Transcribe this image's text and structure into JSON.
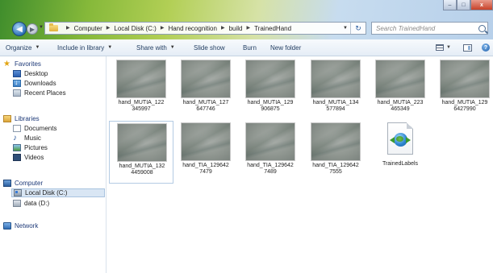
{
  "window": {
    "controls": [
      "–",
      "□",
      "x"
    ]
  },
  "address_bar": {
    "crumbs": [
      "Computer",
      "Local Disk (C:)",
      "Hand recognition",
      "build",
      "TrainedHand"
    ],
    "refresh_glyph": "↻"
  },
  "search": {
    "placeholder": "Search TrainedHand"
  },
  "toolbar": {
    "organize": "Organize",
    "include_in_library": "Include in library",
    "share_with": "Share with",
    "slide_show": "Slide show",
    "burn": "Burn",
    "new_folder": "New folder",
    "help": "?"
  },
  "nav": {
    "favorites": "Favorites",
    "desktop": "Desktop",
    "downloads": "Downloads",
    "recent_places": "Recent Places",
    "libraries": "Libraries",
    "documents": "Documents",
    "music": "Music",
    "pictures": "Pictures",
    "videos": "Videos",
    "computer": "Computer",
    "local_disk_c": "Local Disk (C:)",
    "data_d": "data (D:)",
    "network": "Network"
  },
  "files": [
    {
      "l1": "hand_MUTIA_122",
      "l2": "345997",
      "type": "image"
    },
    {
      "l1": "hand_MUTIA_127",
      "l2": "647746",
      "type": "image"
    },
    {
      "l1": "hand_MUTIA_129",
      "l2": "906875",
      "type": "image"
    },
    {
      "l1": "hand_MUTIA_134",
      "l2": "577894",
      "type": "image"
    },
    {
      "l1": "hand_MUTIA_223",
      "l2": "465349",
      "type": "image"
    },
    {
      "l1": "hand_MUTIA_129",
      "l2": "6427990",
      "type": "image"
    },
    {
      "l1": "hand_MUTIA_132",
      "l2": "4459008",
      "type": "image",
      "selected": true
    },
    {
      "l1": "hand_TIA_129642",
      "l2": "7479",
      "type": "image"
    },
    {
      "l1": "hand_TIA_129642",
      "l2": "7489",
      "type": "image"
    },
    {
      "l1": "hand_TIA_129642",
      "l2": "7555",
      "type": "image"
    },
    {
      "l1": "TrainedLabels",
      "l2": "",
      "type": "xml"
    }
  ]
}
